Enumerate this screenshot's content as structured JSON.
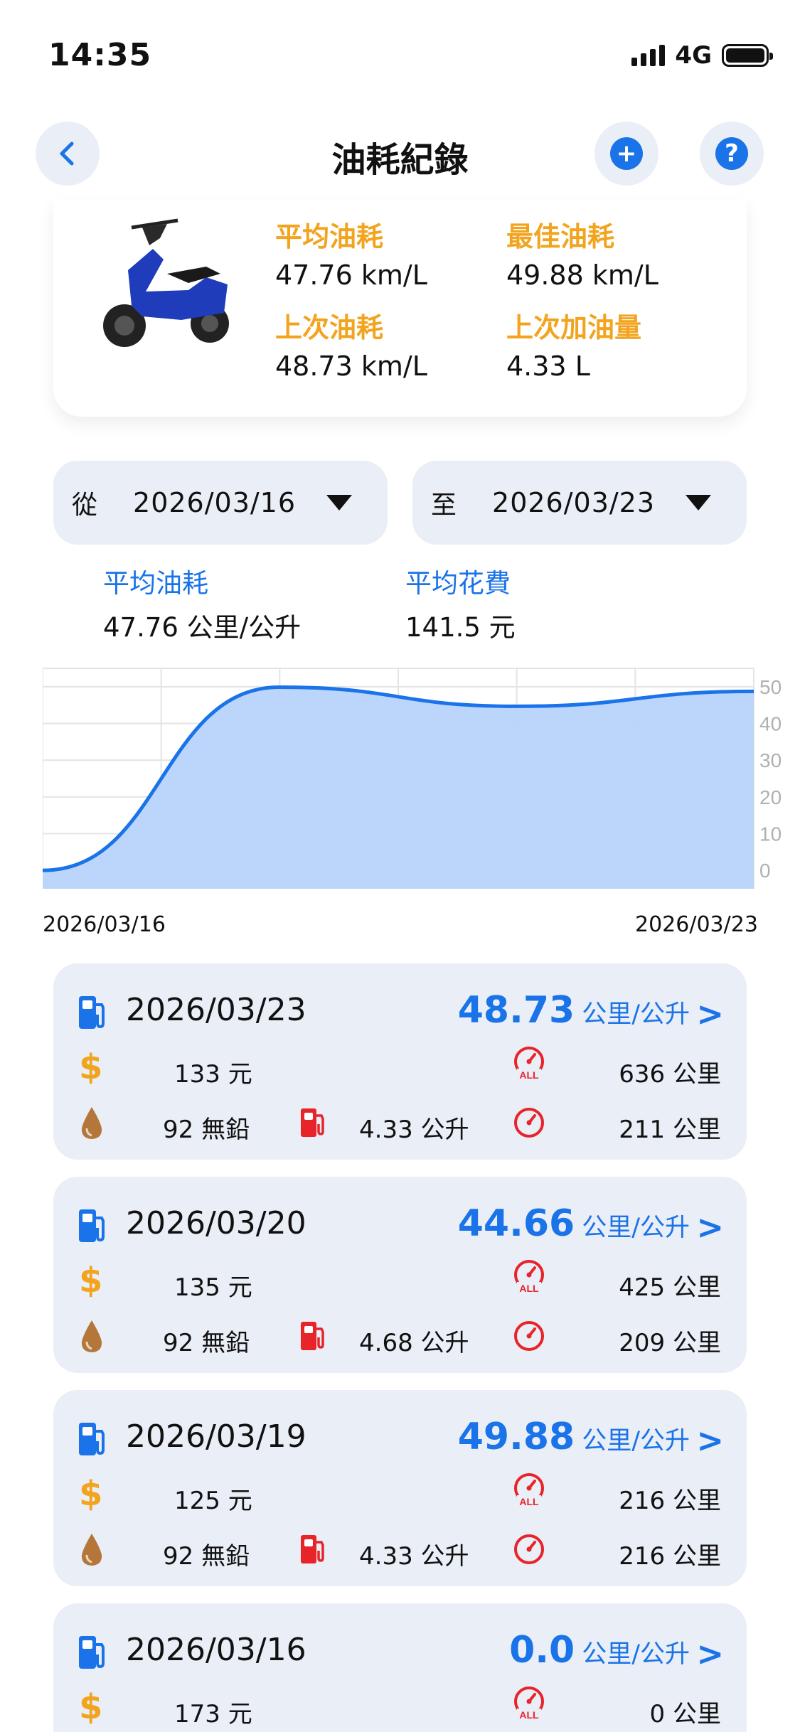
{
  "status_bar": {
    "time": "14:35",
    "network": "4G"
  },
  "nav": {
    "title": "油耗紀錄",
    "back_icon": "chevron-left-icon",
    "add_icon": "plus-circle-icon",
    "help_icon": "question-circle-icon"
  },
  "summary": {
    "avg_label": "平均油耗",
    "avg_value": "47.76 km/L",
    "best_label": "最佳油耗",
    "best_value": "49.88 km/L",
    "last_label": "上次油耗",
    "last_value": "48.73 km/L",
    "last_fill_label": "上次加油量",
    "last_fill_value": "4.33 L"
  },
  "range": {
    "from_prefix": "從",
    "from_date": "2026/03/16",
    "to_prefix": "至",
    "to_date": "2026/03/23"
  },
  "averages": {
    "eff_label": "平均油耗",
    "eff_value": "47.76 公里/公升",
    "cost_label": "平均花費",
    "cost_value": "141.5 元"
  },
  "chart_data": {
    "type": "area",
    "x": [
      "2026/03/16",
      "2026/03/19",
      "2026/03/20",
      "2026/03/23"
    ],
    "values": [
      0.0,
      49.88,
      44.66,
      48.73
    ],
    "x_tick_labels": [
      "2026/03/16",
      "2026/03/23"
    ],
    "y_ticks": [
      0,
      10,
      20,
      30,
      40,
      50
    ],
    "ylim": [
      -5,
      55
    ],
    "grid": true,
    "line_color": "#1a73e8",
    "fill_color": "#b7d3fb"
  },
  "records": [
    {
      "date": "2026/03/23",
      "efficiency": "48.73",
      "unit": "公里/公升",
      "cost": "133 元",
      "total_km": "636 公里",
      "grade": "92 無鉛",
      "volume": "4.33 公升",
      "trip_km": "211 公里"
    },
    {
      "date": "2026/03/20",
      "efficiency": "44.66",
      "unit": "公里/公升",
      "cost": "135 元",
      "total_km": "425 公里",
      "grade": "92 無鉛",
      "volume": "4.68 公升",
      "trip_km": "209 公里"
    },
    {
      "date": "2026/03/19",
      "efficiency": "49.88",
      "unit": "公里/公升",
      "cost": "125 元",
      "total_km": "216 公里",
      "grade": "92 無鉛",
      "volume": "4.33 公升",
      "trip_km": "216 公里"
    },
    {
      "date": "2026/03/16",
      "efficiency": "0.0",
      "unit": "公里/公升",
      "cost": "173 元",
      "total_km": "0 公里",
      "grade": "",
      "volume": "",
      "trip_km": ""
    }
  ],
  "icons": {
    "dollar": "$",
    "gauge_all_text": "ALL"
  },
  "colors": {
    "accent_blue": "#1a73e8",
    "accent_orange": "#f2a41f",
    "icon_red": "#e8242b",
    "drop_brown": "#b5763a",
    "card_bg": "#eaeef6"
  }
}
